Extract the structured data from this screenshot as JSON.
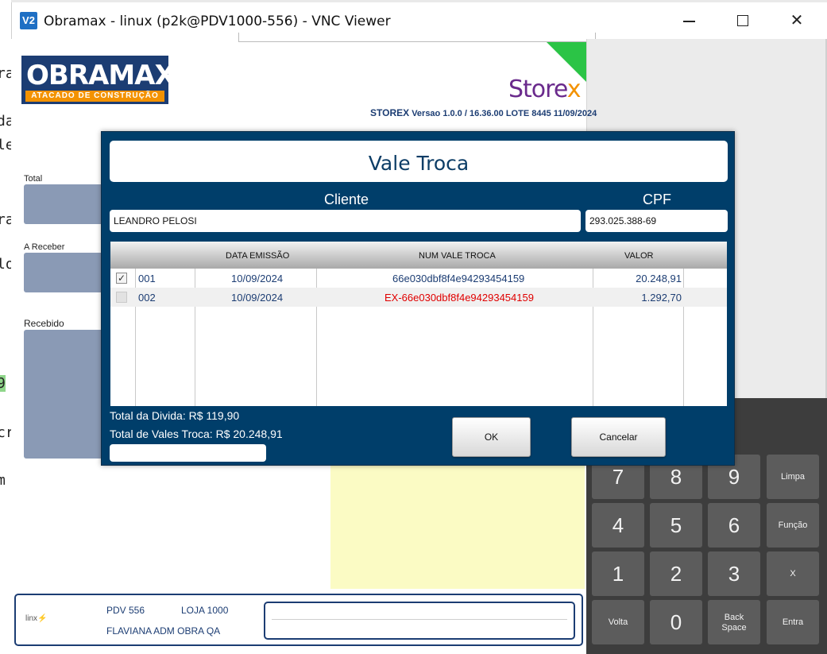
{
  "window": {
    "icon": "V2",
    "title": "Obramax - linux (p2k@PDV1000-556) - VNC Viewer",
    "minimize_icon": "minimize-icon",
    "maximize_icon": "maximize-icon",
    "close_icon": "close-icon"
  },
  "background_fragments": [
    "ra",
    "da",
    "le",
    "ra",
    "lo",
    "9",
    "cr",
    "m"
  ],
  "brand": {
    "logo_main": "OBRAMAX",
    "logo_sub": "ATACADO DE CONSTRUÇÃO",
    "storex_prefix": "Store",
    "storex_suffix": "x",
    "version_app": "STOREX",
    "version_text": "Versao 1.0.0 / 16.36.00 LOTE 8445 11/09/2024"
  },
  "side": {
    "total_label": "Total",
    "a_receber_label": "A Receber",
    "recebido_label": "Recebido"
  },
  "dialog": {
    "title": "Vale Troca",
    "cliente_label": "Cliente",
    "cpf_label": "CPF",
    "cliente_value": "LEANDRO PELOSI",
    "cpf_value": "293.025.388-69",
    "columns": {
      "data_emissao": "DATA EMISSÃO",
      "num_vale_troca": "NUM VALE TROCA",
      "valor": "VALOR"
    },
    "rows": [
      {
        "checked": true,
        "seq": "001",
        "data_emissao": "10/09/2024",
        "num_vale_troca": "66e030dbf8f4e94293454159",
        "valor": "20.248,91",
        "check_glyph": "✓"
      },
      {
        "checked": false,
        "seq": "002",
        "data_emissao": "10/09/2024",
        "num_vale_troca": "EX-66e030dbf8f4e94293454159",
        "valor": "1.292,70",
        "check_glyph": ""
      }
    ],
    "total_divida": "Total da Divida: R$ 119,90",
    "total_vales": "Total de Vales Troca: R$ 20.248,91",
    "ok_label": "OK",
    "cancel_label": "Cancelar"
  },
  "keypad": {
    "row1": [
      "7",
      "8",
      "9",
      "Limpa"
    ],
    "row2": [
      "4",
      "5",
      "6",
      "Função"
    ],
    "row3": [
      "1",
      "2",
      "3",
      "X"
    ],
    "row4": [
      "Volta",
      "0",
      "Back",
      "Space",
      "Entra"
    ]
  },
  "footer": {
    "linx": "linx",
    "pdv": "PDV  556",
    "loja": "LOJA  1000",
    "operator": "FLAVIANA ADM OBRA QA"
  },
  "colors": {
    "dialog_bg": "#003e6a",
    "brand_blue": "#1c3d73",
    "brand_orange": "#f39200",
    "storex_purple": "#6a2a8c",
    "keypad_bg": "#3d3d3d",
    "yellow_panel": "#fbfbc4",
    "alert_red": "#e00000"
  }
}
